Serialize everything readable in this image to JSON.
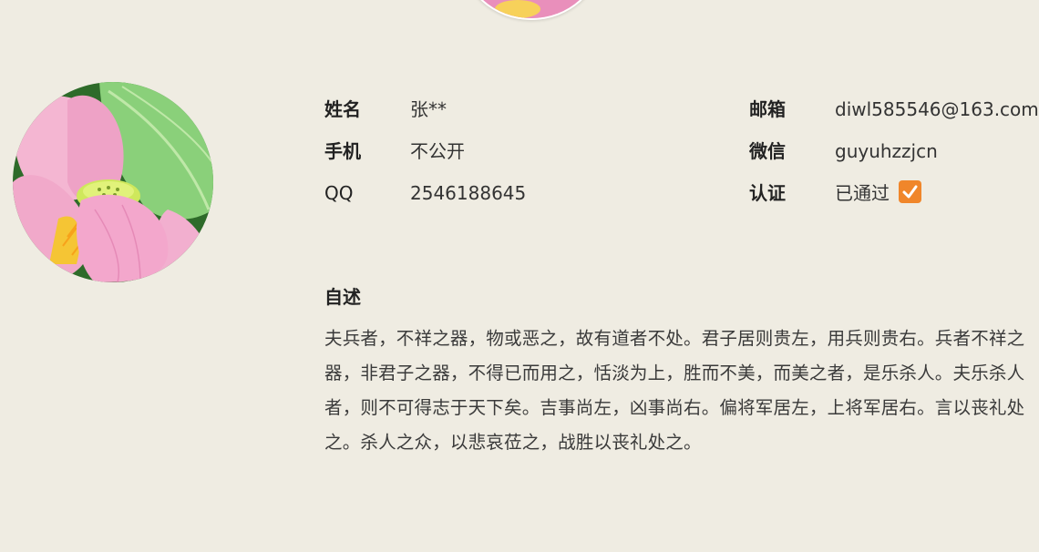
{
  "profile": {
    "fields": {
      "name_label": "姓名",
      "name_value": "张**",
      "phone_label": "手机",
      "phone_value": "不公开",
      "qq_label": "QQ",
      "qq_value": "2546188645",
      "email_label": "邮箱",
      "email_value": "diwl585546@163.com",
      "wechat_label": "微信",
      "wechat_value": "guyuhzzjcn",
      "verify_label": "认证",
      "verify_value": "已通过"
    },
    "verified": true,
    "about_label": "自述",
    "about_text": "夫兵者，不祥之器，物或恶之，故有道者不处。君子居则贵左，用兵则贵右。兵者不祥之器，非君子之器，不得已而用之，恬淡为上，胜而不美，而美之者，是乐杀人。夫乐杀人者，则不可得志于天下矣。吉事尚左，凶事尚右。偏将军居左，上将军居右。言以丧礼处之。杀人之众，以悲哀莅之，战胜以丧礼处之。"
  },
  "colors": {
    "background": "#efece2",
    "check_accent": "#f0862a"
  },
  "icons": {
    "verified": "checkbox-checked-icon"
  }
}
